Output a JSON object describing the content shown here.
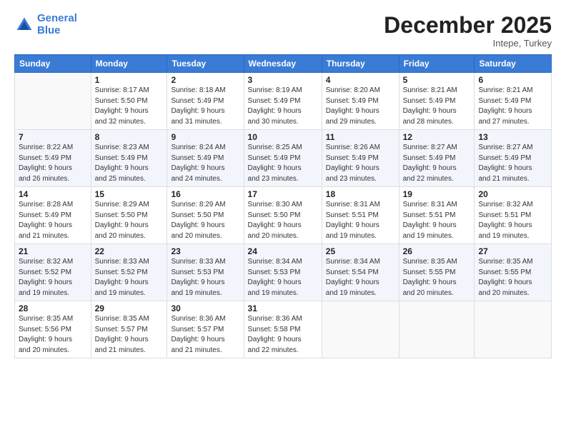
{
  "logo": {
    "line1": "General",
    "line2": "Blue"
  },
  "title": "December 2025",
  "location": "Intepe, Turkey",
  "days_of_week": [
    "Sunday",
    "Monday",
    "Tuesday",
    "Wednesday",
    "Thursday",
    "Friday",
    "Saturday"
  ],
  "weeks": [
    [
      {
        "day": "",
        "info": ""
      },
      {
        "day": "1",
        "info": "Sunrise: 8:17 AM\nSunset: 5:50 PM\nDaylight: 9 hours\nand 32 minutes."
      },
      {
        "day": "2",
        "info": "Sunrise: 8:18 AM\nSunset: 5:49 PM\nDaylight: 9 hours\nand 31 minutes."
      },
      {
        "day": "3",
        "info": "Sunrise: 8:19 AM\nSunset: 5:49 PM\nDaylight: 9 hours\nand 30 minutes."
      },
      {
        "day": "4",
        "info": "Sunrise: 8:20 AM\nSunset: 5:49 PM\nDaylight: 9 hours\nand 29 minutes."
      },
      {
        "day": "5",
        "info": "Sunrise: 8:21 AM\nSunset: 5:49 PM\nDaylight: 9 hours\nand 28 minutes."
      },
      {
        "day": "6",
        "info": "Sunrise: 8:21 AM\nSunset: 5:49 PM\nDaylight: 9 hours\nand 27 minutes."
      }
    ],
    [
      {
        "day": "7",
        "info": "Sunrise: 8:22 AM\nSunset: 5:49 PM\nDaylight: 9 hours\nand 26 minutes."
      },
      {
        "day": "8",
        "info": "Sunrise: 8:23 AM\nSunset: 5:49 PM\nDaylight: 9 hours\nand 25 minutes."
      },
      {
        "day": "9",
        "info": "Sunrise: 8:24 AM\nSunset: 5:49 PM\nDaylight: 9 hours\nand 24 minutes."
      },
      {
        "day": "10",
        "info": "Sunrise: 8:25 AM\nSunset: 5:49 PM\nDaylight: 9 hours\nand 23 minutes."
      },
      {
        "day": "11",
        "info": "Sunrise: 8:26 AM\nSunset: 5:49 PM\nDaylight: 9 hours\nand 23 minutes."
      },
      {
        "day": "12",
        "info": "Sunrise: 8:27 AM\nSunset: 5:49 PM\nDaylight: 9 hours\nand 22 minutes."
      },
      {
        "day": "13",
        "info": "Sunrise: 8:27 AM\nSunset: 5:49 PM\nDaylight: 9 hours\nand 21 minutes."
      }
    ],
    [
      {
        "day": "14",
        "info": "Sunrise: 8:28 AM\nSunset: 5:49 PM\nDaylight: 9 hours\nand 21 minutes."
      },
      {
        "day": "15",
        "info": "Sunrise: 8:29 AM\nSunset: 5:50 PM\nDaylight: 9 hours\nand 20 minutes."
      },
      {
        "day": "16",
        "info": "Sunrise: 8:29 AM\nSunset: 5:50 PM\nDaylight: 9 hours\nand 20 minutes."
      },
      {
        "day": "17",
        "info": "Sunrise: 8:30 AM\nSunset: 5:50 PM\nDaylight: 9 hours\nand 20 minutes."
      },
      {
        "day": "18",
        "info": "Sunrise: 8:31 AM\nSunset: 5:51 PM\nDaylight: 9 hours\nand 19 minutes."
      },
      {
        "day": "19",
        "info": "Sunrise: 8:31 AM\nSunset: 5:51 PM\nDaylight: 9 hours\nand 19 minutes."
      },
      {
        "day": "20",
        "info": "Sunrise: 8:32 AM\nSunset: 5:51 PM\nDaylight: 9 hours\nand 19 minutes."
      }
    ],
    [
      {
        "day": "21",
        "info": "Sunrise: 8:32 AM\nSunset: 5:52 PM\nDaylight: 9 hours\nand 19 minutes."
      },
      {
        "day": "22",
        "info": "Sunrise: 8:33 AM\nSunset: 5:52 PM\nDaylight: 9 hours\nand 19 minutes."
      },
      {
        "day": "23",
        "info": "Sunrise: 8:33 AM\nSunset: 5:53 PM\nDaylight: 9 hours\nand 19 minutes."
      },
      {
        "day": "24",
        "info": "Sunrise: 8:34 AM\nSunset: 5:53 PM\nDaylight: 9 hours\nand 19 minutes."
      },
      {
        "day": "25",
        "info": "Sunrise: 8:34 AM\nSunset: 5:54 PM\nDaylight: 9 hours\nand 19 minutes."
      },
      {
        "day": "26",
        "info": "Sunrise: 8:35 AM\nSunset: 5:55 PM\nDaylight: 9 hours\nand 20 minutes."
      },
      {
        "day": "27",
        "info": "Sunrise: 8:35 AM\nSunset: 5:55 PM\nDaylight: 9 hours\nand 20 minutes."
      }
    ],
    [
      {
        "day": "28",
        "info": "Sunrise: 8:35 AM\nSunset: 5:56 PM\nDaylight: 9 hours\nand 20 minutes."
      },
      {
        "day": "29",
        "info": "Sunrise: 8:35 AM\nSunset: 5:57 PM\nDaylight: 9 hours\nand 21 minutes."
      },
      {
        "day": "30",
        "info": "Sunrise: 8:36 AM\nSunset: 5:57 PM\nDaylight: 9 hours\nand 21 minutes."
      },
      {
        "day": "31",
        "info": "Sunrise: 8:36 AM\nSunset: 5:58 PM\nDaylight: 9 hours\nand 22 minutes."
      },
      {
        "day": "",
        "info": ""
      },
      {
        "day": "",
        "info": ""
      },
      {
        "day": "",
        "info": ""
      }
    ]
  ]
}
